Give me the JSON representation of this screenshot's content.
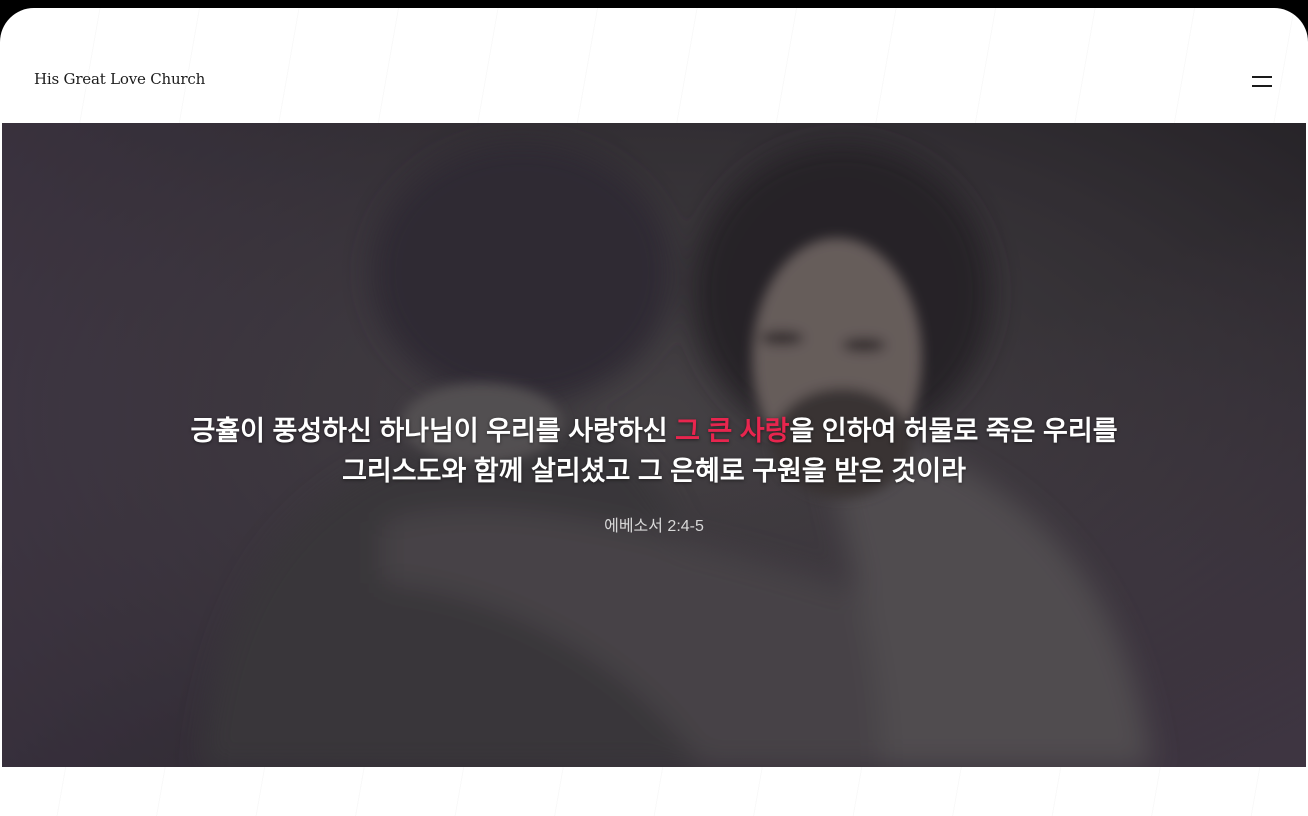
{
  "header": {
    "logo_text": "His Great Love Church",
    "menu_icon": "hamburger-menu-icon"
  },
  "hero": {
    "image_alt": "embrace-photo",
    "verse": {
      "line1_part1": "긍휼이 풍성하신 하나님이 우리를 사랑하신 ",
      "line1_highlight": "그 큰 사랑",
      "line1_part2": "을 인하여 허물로 죽은 우리를",
      "line2": "그리스도와 함께 살리셨고 그 은혜로 구원을 받은 것이라"
    },
    "reference": "에베소서 2:4-5"
  },
  "colors": {
    "highlight": "#e8254e",
    "text_light": "#ffffff",
    "page_bg": "#ffffff"
  }
}
